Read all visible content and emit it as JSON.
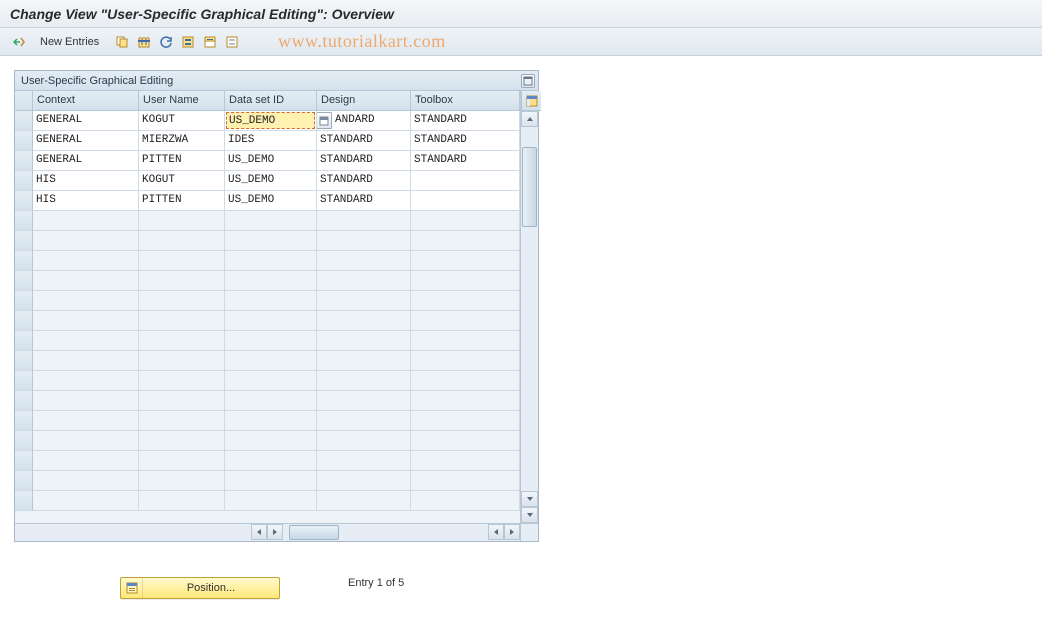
{
  "title": "Change View \"User-Specific Graphical Editing\": Overview",
  "toolbar": {
    "new_entries_label": "New Entries"
  },
  "watermark": "www.tutorialkart.com",
  "panel": {
    "title": "User-Specific Graphical Editing"
  },
  "columns": {
    "context": "Context",
    "user": "User Name",
    "dataset": "Data set ID",
    "design": "Design",
    "toolbox": "Toolbox"
  },
  "active_cell": {
    "row": 0,
    "col": "dataset",
    "value": "US_DEMO"
  },
  "rows": [
    {
      "context": "GENERAL",
      "user": "KOGUT",
      "dataset": "US_DEMO",
      "design": "ANDARD",
      "toolbox": "STANDARD"
    },
    {
      "context": "GENERAL",
      "user": "MIERZWA",
      "dataset": "IDES",
      "design": "STANDARD",
      "toolbox": "STANDARD"
    },
    {
      "context": "GENERAL",
      "user": "PITTEN",
      "dataset": "US_DEMO",
      "design": "STANDARD",
      "toolbox": "STANDARD"
    },
    {
      "context": "HIS",
      "user": "KOGUT",
      "dataset": "US_DEMO",
      "design": "STANDARD",
      "toolbox": ""
    },
    {
      "context": "HIS",
      "user": "PITTEN",
      "dataset": "US_DEMO",
      "design": "STANDARD",
      "toolbox": ""
    }
  ],
  "footer": {
    "position_label": "Position...",
    "status": "Entry 1 of 5"
  },
  "empty_row_count": 15
}
